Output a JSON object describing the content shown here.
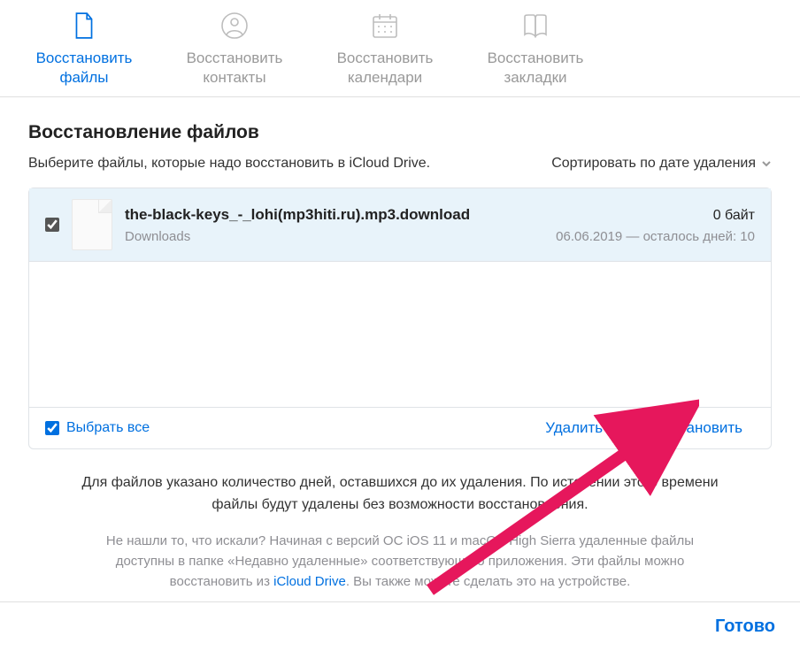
{
  "tabs": [
    {
      "label": "Восстановить файлы",
      "icon": "file"
    },
    {
      "label": "Восстановить контакты",
      "icon": "contact"
    },
    {
      "label": "Восстановить календари",
      "icon": "calendar"
    },
    {
      "label": "Восстановить закладки",
      "icon": "bookmark"
    }
  ],
  "active_tab": 0,
  "heading": "Восстановление файлов",
  "instruction": "Выберите файлы, которые надо восстановить в iCloud Drive.",
  "sort_label": "Сортировать по дате удаления",
  "files": [
    {
      "name": "the-black-keys_-_lohi(mp3hiti.ru).mp3.download",
      "size": "0 байт",
      "location": "Downloads",
      "deleted_info": "06.06.2019 — осталось дней: 10",
      "selected": true
    }
  ],
  "select_all_label": "Выбрать все",
  "select_all_checked": true,
  "delete_label": "Удалить",
  "restore_label": "Восстановить",
  "note_primary": "Для файлов указано количество дней, оставшихся до их удаления. По истечении этого времени файлы будут удалены без возможности восстановления.",
  "note_secondary_pre": "Не нашли то, что искали? Начиная с версий ОС iOS 11 и macOS High Sierra удаленные файлы доступны в папке «Недавно удаленные» соответствующего приложения. Эти файлы можно восстановить из ",
  "note_secondary_link": "iCloud Drive",
  "note_secondary_post": ". Вы также можете сделать это на устройстве.",
  "done_label": "Готово",
  "colors": {
    "accent": "#0070e0",
    "arrow": "#e6175c"
  }
}
